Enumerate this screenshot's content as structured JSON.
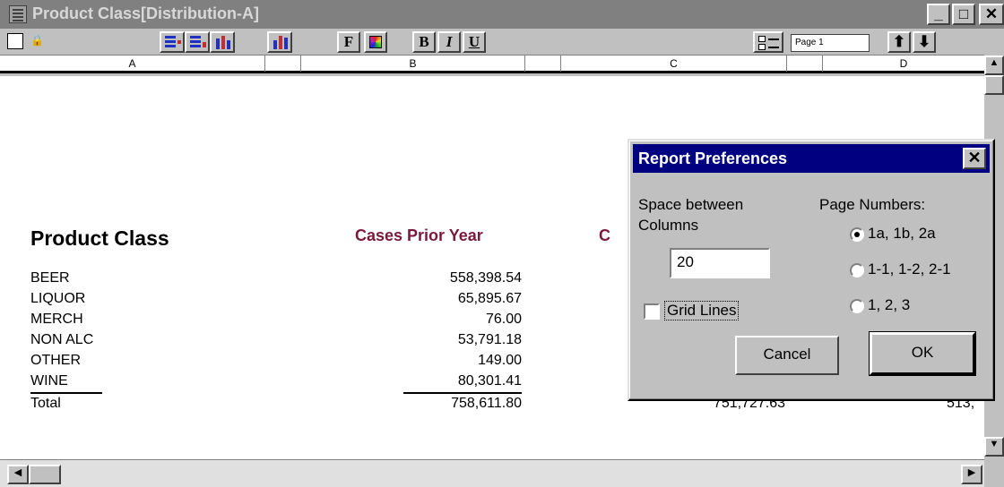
{
  "window": {
    "title": "Product Class[Distribution-A]",
    "minimize_label": "_",
    "maximize_label": "□",
    "close_label": "✕"
  },
  "toolbar": {
    "bold_label": "B",
    "italic_label": "I",
    "underline_label": "U",
    "font_label": "F",
    "page_value": "Page 1",
    "up_label": "⬆",
    "down_label": "⬇"
  },
  "columns": [
    "A",
    "B",
    "C",
    "D"
  ],
  "report": {
    "header_product_class": "Product Class",
    "header_cases_prior_year": "Cases Prior Year",
    "header_c_partial": "C",
    "rows": [
      {
        "name": "BEER",
        "cases_prior_year": "558,398.54"
      },
      {
        "name": "LIQUOR",
        "cases_prior_year": "65,895.67"
      },
      {
        "name": "MERCH",
        "cases_prior_year": "76.00"
      },
      {
        "name": "NON ALC",
        "cases_prior_year": "53,791.18"
      },
      {
        "name": "OTHER",
        "cases_prior_year": "149.00"
      },
      {
        "name": "WINE",
        "cases_prior_year": "80,301.41"
      }
    ],
    "total_label": "Total",
    "total_cases_prior_year": "758,611.80",
    "total_col_c": "751,727.63",
    "total_col_d_partial": "513,"
  },
  "dialog": {
    "title": "Report Preferences",
    "close_label": "✕",
    "space_label_line1": "Space between",
    "space_label_line2": "Columns",
    "space_value": "20",
    "grid_lines_label": "Grid Lines",
    "grid_lines_checked": false,
    "page_numbers_label": "Page Numbers:",
    "page_number_options": [
      "1a, 1b, 2a",
      "1-1, 1-2, 2-1",
      "1, 2, 3"
    ],
    "page_number_selected": "1a, 1b, 2a",
    "cancel_label": "Cancel",
    "ok_label": "OK"
  }
}
